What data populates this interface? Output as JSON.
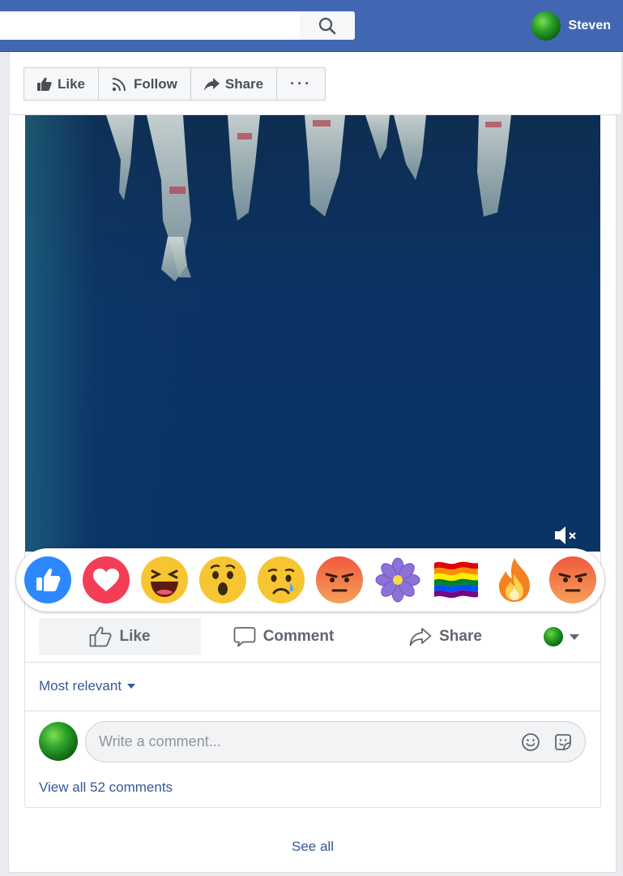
{
  "topbar": {
    "search_value": "",
    "search_placeholder": "",
    "user_name": "Steven"
  },
  "page_actions": {
    "like": "Like",
    "follow": "Follow",
    "share": "Share",
    "more": "···"
  },
  "reactions": [
    {
      "name": "like",
      "icon": "thumbs-up-icon",
      "color": "#2d88ff"
    },
    {
      "name": "love",
      "icon": "heart-icon",
      "color": "#f33e58"
    },
    {
      "name": "haha",
      "icon": "laughing-face-icon",
      "color": "#f7b125"
    },
    {
      "name": "wow",
      "icon": "surprised-face-icon",
      "color": "#f7b125"
    },
    {
      "name": "sad",
      "icon": "sad-face-icon",
      "color": "#f7b125"
    },
    {
      "name": "angry",
      "icon": "angry-face-icon",
      "color": "#e9710f"
    },
    {
      "name": "flower",
      "icon": "purple-flower-icon",
      "color": "#8c6fd6"
    },
    {
      "name": "pride",
      "icon": "rainbow-flag-icon",
      "color": "#e40303"
    },
    {
      "name": "fire",
      "icon": "fire-icon",
      "color": "#f58220"
    },
    {
      "name": "angry-2",
      "icon": "angry-face-icon",
      "color": "#e9710f"
    }
  ],
  "post_actions": {
    "like": "Like",
    "comment": "Comment",
    "share": "Share"
  },
  "comments": {
    "sort_label": "Most relevant",
    "input_placeholder": "Write a comment...",
    "view_all": "View all 52 comments",
    "see_all": "See all"
  },
  "colors": {
    "brand_blue": "#4267b2",
    "link_blue": "#365899"
  }
}
